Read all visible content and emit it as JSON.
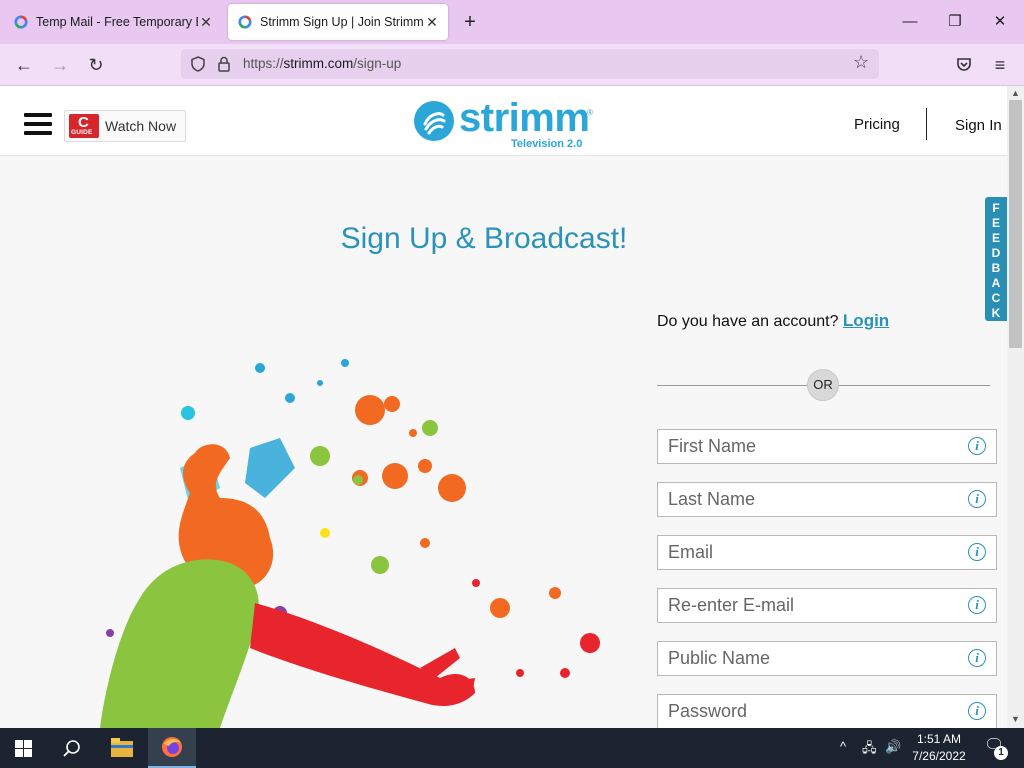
{
  "browser": {
    "tabs": [
      {
        "title": "Temp Mail - Free Temporary Email",
        "active": false
      },
      {
        "title": "Strimm Sign Up | Join Strimm",
        "active": true
      }
    ],
    "url_scheme": "https://",
    "url_host": "strimm.com",
    "url_path": "/sign-up"
  },
  "header": {
    "watch_now_label": "Watch Now",
    "cguide_letter": "C",
    "cguide_word": "GUIDE",
    "logo_word": "strimm",
    "logo_sub": "Television 2.0",
    "logo_reg": "®",
    "pricing_label": "Pricing",
    "signin_label": "Sign In"
  },
  "main": {
    "title": "Sign Up & Broadcast!",
    "feedback_label": "FEEDBACK",
    "account_prompt": "Do you have an account?",
    "login_label": "Login",
    "or_label": "OR",
    "fields": {
      "first_name": "First Name",
      "last_name": "Last Name",
      "email": "Email",
      "reenter_email": "Re-enter E-mail",
      "public_name": "Public Name",
      "password": "Password"
    },
    "info_glyph": "i"
  },
  "taskbar": {
    "time": "1:51 AM",
    "date": "7/26/2022",
    "notification_count": "1"
  },
  "colors": {
    "accent": "#2a93b8",
    "logo": "#2aa6d8",
    "tabbar": "#e8c8f0",
    "feedback": "#2a8fb5"
  },
  "icons": [
    "back-icon",
    "forward-icon",
    "reload-icon",
    "shield-icon",
    "lock-icon",
    "bookmark-star-icon",
    "pocket-icon",
    "menu-icon",
    "hamburger-icon",
    "info-icon",
    "windows-start-icon",
    "search-icon",
    "file-explorer-icon",
    "firefox-icon"
  ]
}
